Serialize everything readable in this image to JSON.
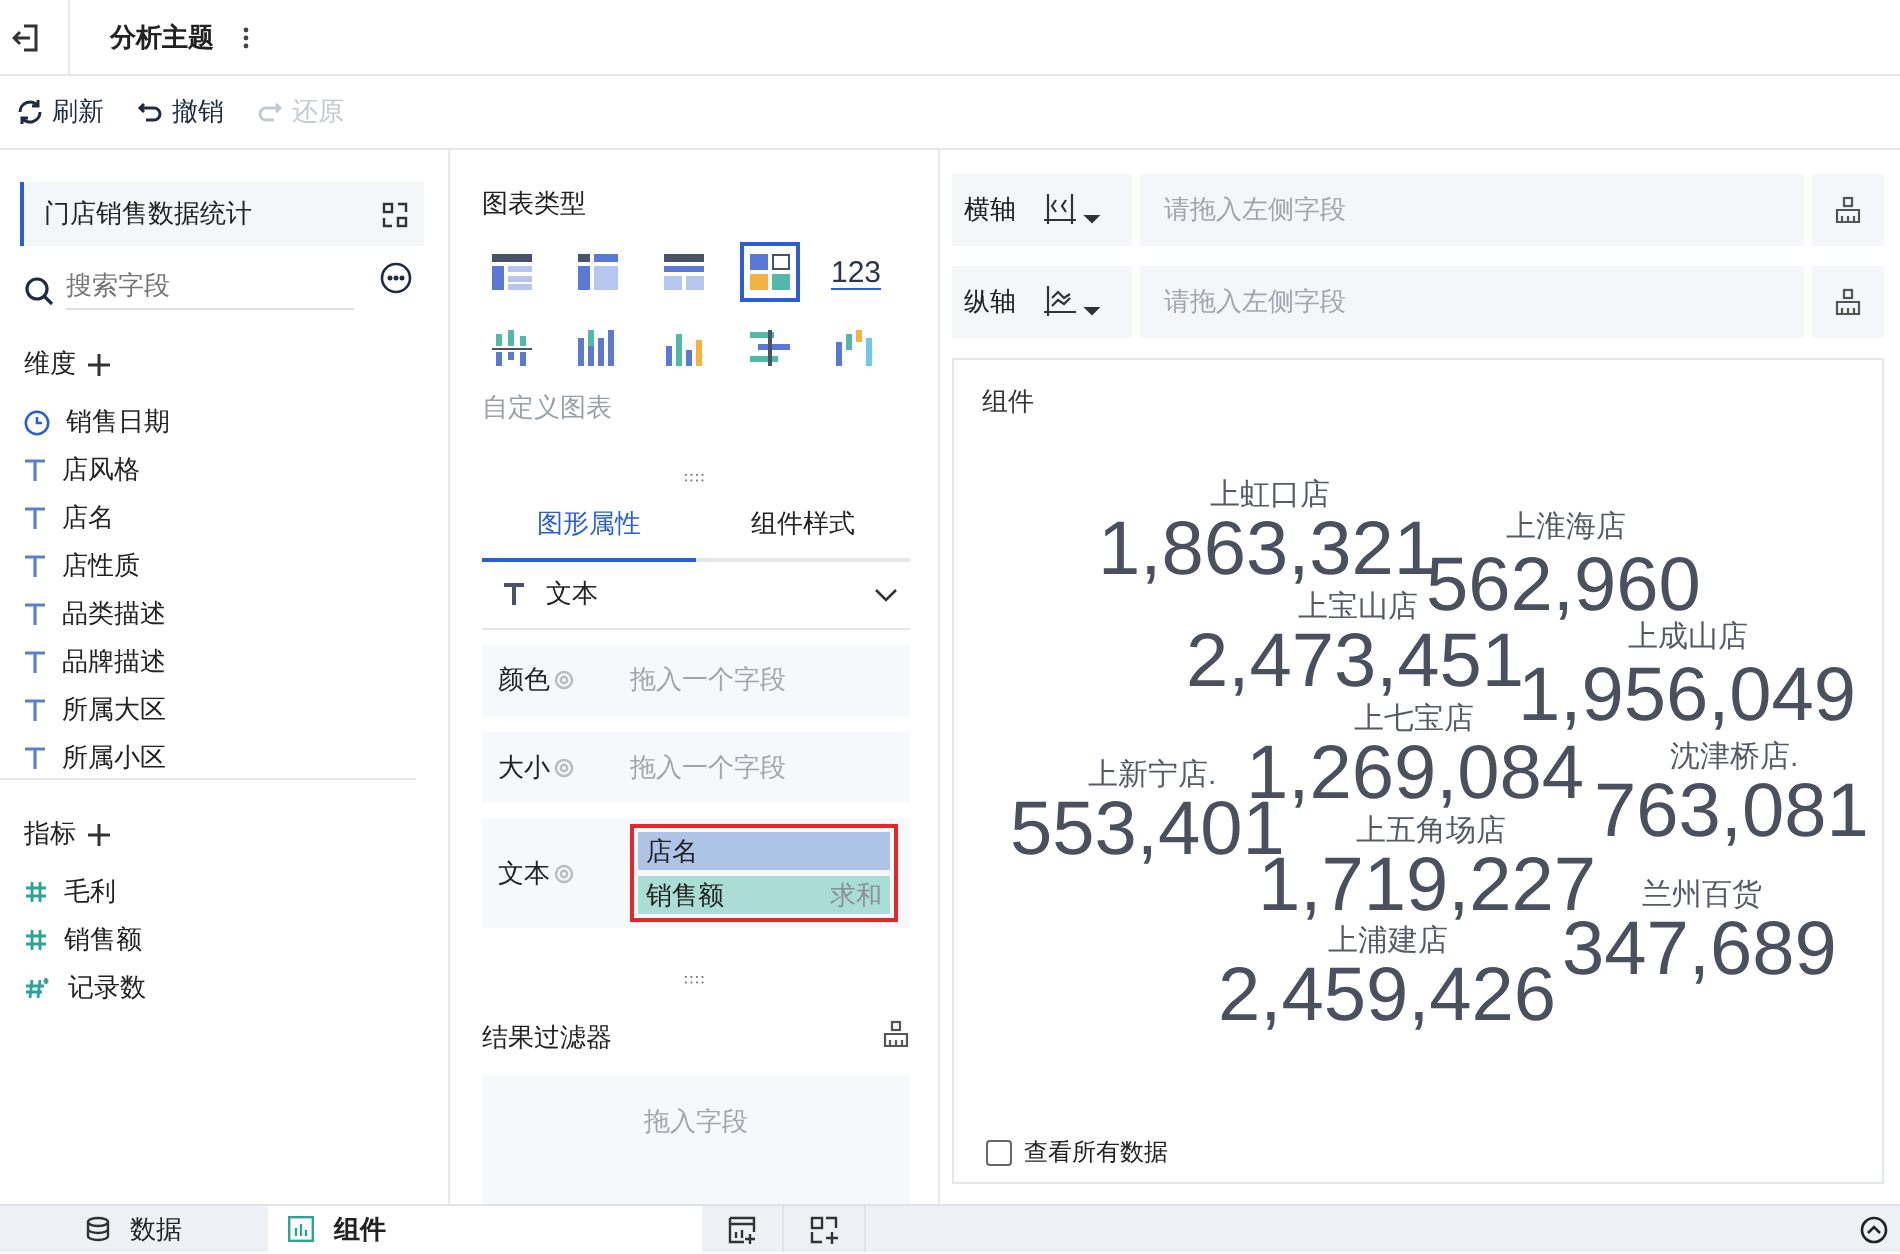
{
  "top_bar": {
    "title": "分析主题"
  },
  "toolbar": [
    {
      "label": "刷新",
      "kind": "refresh",
      "disabled": false
    },
    {
      "label": "撤销",
      "kind": "undo",
      "disabled": false
    },
    {
      "label": "还原",
      "kind": "redo",
      "disabled": true
    }
  ],
  "dataset": {
    "name": "门店销售数据统计"
  },
  "search": {
    "placeholder": "搜索字段"
  },
  "dimensions": {
    "label": "维度",
    "items": [
      {
        "label": "销售日期",
        "kind": "date"
      },
      {
        "label": "店风格",
        "kind": "text"
      },
      {
        "label": "店名",
        "kind": "text"
      },
      {
        "label": "店性质",
        "kind": "text"
      },
      {
        "label": "品类描述",
        "kind": "text"
      },
      {
        "label": "品牌描述",
        "kind": "text"
      },
      {
        "label": "所属大区",
        "kind": "text"
      },
      {
        "label": "所属小区",
        "kind": "text"
      }
    ]
  },
  "measures": {
    "label": "指标",
    "items": [
      {
        "label": "毛利",
        "kind": "number"
      },
      {
        "label": "销售额",
        "kind": "number"
      },
      {
        "label": "记录数",
        "kind": "count"
      }
    ]
  },
  "chart_types": {
    "title": "图表类型",
    "custom_label": "自定义图表",
    "items": [
      {
        "kind": "table",
        "selected": false
      },
      {
        "kind": "cross_table",
        "selected": false
      },
      {
        "kind": "detail_table",
        "selected": false
      },
      {
        "kind": "custom",
        "selected": true
      },
      {
        "kind": "number",
        "label": "123",
        "selected": false
      },
      {
        "kind": "stacked_bar",
        "selected": false
      },
      {
        "kind": "multi_bar",
        "selected": false
      },
      {
        "kind": "bar",
        "selected": false
      },
      {
        "kind": "bullet",
        "selected": false
      },
      {
        "kind": "waterfall",
        "selected": false
      }
    ]
  },
  "property_tabs": [
    {
      "label": "图形属性",
      "selected": true
    },
    {
      "label": "组件样式",
      "selected": false
    }
  ],
  "mark_type": {
    "label": "文本"
  },
  "property_rows": [
    {
      "label": "颜色",
      "placeholder": "拖入一个字段"
    },
    {
      "label": "大小",
      "placeholder": "拖入一个字段"
    },
    {
      "label": "文本",
      "highlighted": true,
      "fields": [
        {
          "name": "店名",
          "kind": "dimension"
        },
        {
          "name": "销售额",
          "kind": "measure",
          "aggregation": "求和"
        }
      ]
    }
  ],
  "filter": {
    "title": "结果过滤器",
    "placeholder": "拖入字段"
  },
  "axes": [
    {
      "label": "横轴",
      "kind": "x",
      "placeholder": "请拖入左侧字段"
    },
    {
      "label": "纵轴",
      "kind": "y",
      "placeholder": "请拖入左侧字段"
    }
  ],
  "component": {
    "title": "组件",
    "words": [
      {
        "name": "上虹口店",
        "value": "1,863,321"
      },
      {
        "name": "上淮海店",
        "value": "562,960"
      },
      {
        "name": "上宝山店",
        "value": "2,473,451"
      },
      {
        "name": "上成山店",
        "value": "1,956,049"
      },
      {
        "name": "上七宝店",
        "value": "1,269,084"
      },
      {
        "name": "上新宁店.",
        "value": "553,401"
      },
      {
        "name": "沈津桥店.",
        "value": "763,081"
      },
      {
        "name": "上五角场店",
        "value": "1,719,227"
      },
      {
        "name": "兰州百货",
        "value": "347,689"
      },
      {
        "name": "上浦建店",
        "value": "2,459,426"
      }
    ],
    "show_all": {
      "label": "查看所有数据",
      "checked": false
    }
  },
  "bottom_tabs": [
    {
      "label": "数据",
      "kind": "data",
      "selected": false
    },
    {
      "label": "组件",
      "kind": "component",
      "selected": true
    }
  ]
}
